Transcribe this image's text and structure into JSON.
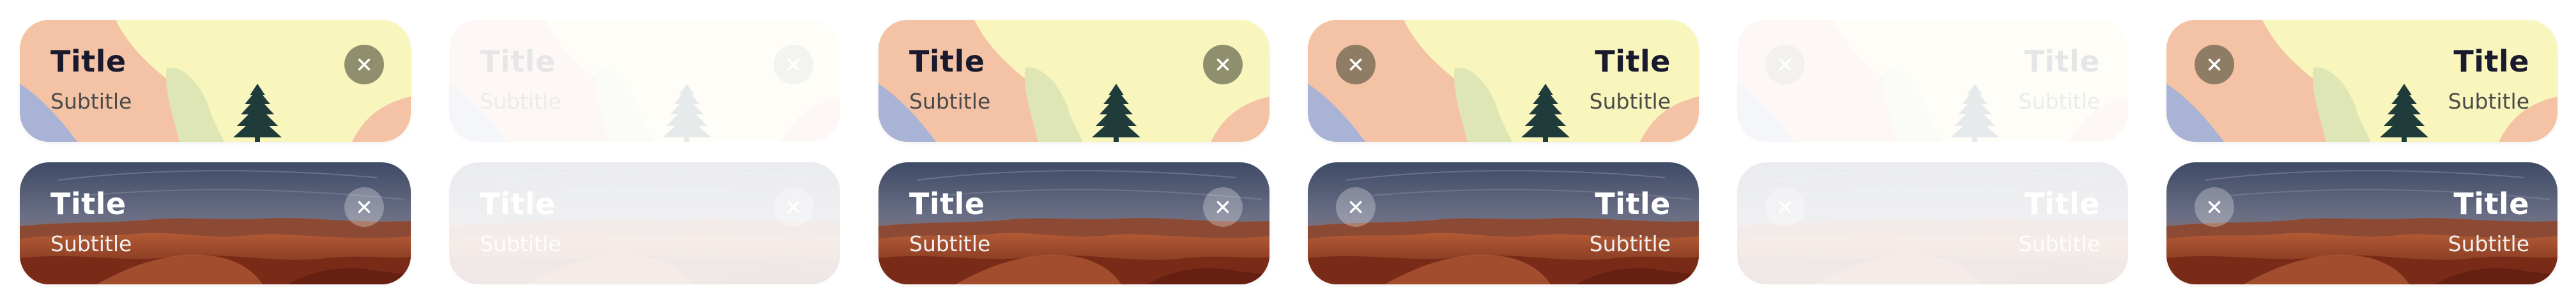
{
  "cards": [
    {
      "title": "Title",
      "subtitle": "Subtitle"
    },
    {
      "title": "Title",
      "subtitle": "Subtitle"
    },
    {
      "title": "Title",
      "subtitle": "Subtitle"
    },
    {
      "title": "Title",
      "subtitle": "Subtitle"
    },
    {
      "title": "Title",
      "subtitle": "Subtitle"
    },
    {
      "title": "Title",
      "subtitle": "Subtitle"
    },
    {
      "title": "Title",
      "subtitle": "Subtitle"
    },
    {
      "title": "Title",
      "subtitle": "Subtitle"
    },
    {
      "title": "Title",
      "subtitle": "Subtitle"
    },
    {
      "title": "Title",
      "subtitle": "Subtitle"
    },
    {
      "title": "Title",
      "subtitle": "Subtitle"
    },
    {
      "title": "Title",
      "subtitle": "Subtitle"
    }
  ],
  "icons": {
    "close": "close-icon",
    "pine_tree": "pine-tree-illustration",
    "canyon": "canyon-illustration"
  },
  "colors": {
    "light_bg": "#f8f5bd",
    "peach": "#f4c3a5",
    "green_hill": "#dde6b4",
    "blue_hill": "#a8b3d6",
    "tree": "#1f3b3a",
    "canyon_sky": "#4a5772",
    "canyon_rock": "#a24a2a",
    "canyon_deep": "#6b2416"
  }
}
